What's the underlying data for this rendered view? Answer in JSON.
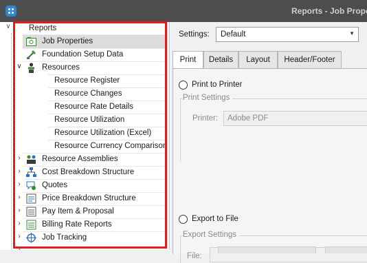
{
  "window": {
    "title": "Reports - Job Prope"
  },
  "tree": {
    "root_label": "Reports",
    "items": [
      {
        "label": "Job Properties",
        "icon": "job-properties-icon",
        "selected": true
      },
      {
        "label": "Foundation Setup Data",
        "icon": "foundation-setup-icon"
      },
      {
        "label": "Resources",
        "icon": "resources-icon",
        "expanded": true
      },
      {
        "label": "Resource Register",
        "child": true
      },
      {
        "label": "Resource Changes",
        "child": true
      },
      {
        "label": "Resource Rate Details",
        "child": true
      },
      {
        "label": "Resource Utilization",
        "child": true
      },
      {
        "label": "Resource Utilization (Excel)",
        "child": true
      },
      {
        "label": "Resource Currency Comparison",
        "child": true
      },
      {
        "label": "Resource Assemblies",
        "icon": "resource-assemblies-icon"
      },
      {
        "label": "Cost Breakdown Structure",
        "icon": "cost-breakdown-icon"
      },
      {
        "label": "Quotes",
        "icon": "quotes-icon"
      },
      {
        "label": "Price Breakdown Structure",
        "icon": "price-breakdown-icon"
      },
      {
        "label": "Pay Item & Proposal",
        "icon": "pay-item-icon"
      },
      {
        "label": "Billing Rate Reports",
        "icon": "billing-rate-icon"
      },
      {
        "label": "Job Tracking",
        "icon": "job-tracking-icon"
      }
    ]
  },
  "settings": {
    "label": "Settings:",
    "value": "Default"
  },
  "tabs": [
    "Print",
    "Details",
    "Layout",
    "Header/Footer"
  ],
  "print_panel": {
    "print_to_printer": "Print to Printer",
    "print_settings_title": "Print Settings",
    "printer_label": "Printer:",
    "printer_value": "Adobe PDF",
    "export_to_file": "Export to File",
    "export_settings_title": "Export Settings",
    "file_label": "File:"
  },
  "colors": {
    "highlight_frame": "#e41b1b",
    "titlebar": "#4d4d4d",
    "app_icon": "#2f86d6"
  }
}
